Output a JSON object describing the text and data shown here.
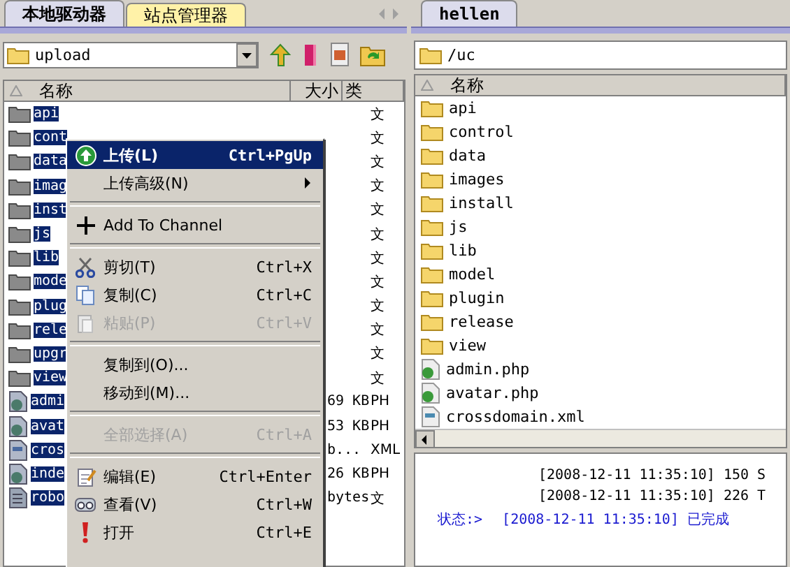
{
  "local": {
    "tabs": [
      {
        "label": "本地驱动器",
        "selected": true
      },
      {
        "label": "站点管理器",
        "selected": false
      }
    ],
    "path": "upload",
    "columns": [
      "名称",
      "大小",
      "类"
    ],
    "rows": [
      {
        "name": "api",
        "size": "",
        "type": "文",
        "kind": "folder",
        "selected": true
      },
      {
        "name": "cont",
        "size": "",
        "type": "文",
        "kind": "folder",
        "selected": true
      },
      {
        "name": "data",
        "size": "",
        "type": "文",
        "kind": "folder",
        "selected": true
      },
      {
        "name": "imag",
        "size": "",
        "type": "文",
        "kind": "folder",
        "selected": true
      },
      {
        "name": "inst",
        "size": "",
        "type": "文",
        "kind": "folder",
        "selected": true
      },
      {
        "name": "js",
        "size": "",
        "type": "文",
        "kind": "folder",
        "selected": true
      },
      {
        "name": "lib",
        "size": "",
        "type": "文",
        "kind": "folder",
        "selected": true
      },
      {
        "name": "mode",
        "size": "",
        "type": "文",
        "kind": "folder",
        "selected": true
      },
      {
        "name": "plug",
        "size": "",
        "type": "文",
        "kind": "folder",
        "selected": true
      },
      {
        "name": "rele",
        "size": "",
        "type": "文",
        "kind": "folder",
        "selected": true
      },
      {
        "name": "upgr",
        "size": "",
        "type": "文",
        "kind": "folder",
        "selected": true
      },
      {
        "name": "view",
        "size": "",
        "type": "文",
        "kind": "folder",
        "selected": true
      },
      {
        "name": "admi",
        "size": "69 KB",
        "type": "PH",
        "kind": "php",
        "selected": true
      },
      {
        "name": "avat",
        "size": "53 KB",
        "type": "PH",
        "kind": "php",
        "selected": true
      },
      {
        "name": "cros",
        "size": "b...",
        "type": "XML",
        "kind": "xml",
        "selected": true
      },
      {
        "name": "inde",
        "size": "26 KB",
        "type": "PH",
        "kind": "php",
        "selected": true
      },
      {
        "name": "robo",
        "size": "bytes",
        "type": "文",
        "kind": "text",
        "selected": true
      }
    ]
  },
  "menu": [
    {
      "kind": "item",
      "label": "上传(L)",
      "shortcut": "Ctrl+PgUp",
      "selected": true,
      "disabled": false
    },
    {
      "kind": "submenu",
      "label": "上传高级(N)",
      "selected": false,
      "disabled": false
    },
    {
      "kind": "separator"
    },
    {
      "kind": "item",
      "label": "Add To Channel",
      "selected": false,
      "disabled": false
    },
    {
      "kind": "separator"
    },
    {
      "kind": "item",
      "label": "剪切(T)",
      "shortcut": "Ctrl+X",
      "selected": false,
      "disabled": false
    },
    {
      "kind": "item",
      "label": "复制(C)",
      "shortcut": "Ctrl+C",
      "selected": false,
      "disabled": false
    },
    {
      "kind": "item",
      "label": "粘贴(P)",
      "shortcut": "Ctrl+V",
      "selected": false,
      "disabled": true
    },
    {
      "kind": "separator"
    },
    {
      "kind": "item",
      "label": "复制到(O)...",
      "selected": false,
      "disabled": false
    },
    {
      "kind": "item",
      "label": "移动到(M)...",
      "selected": false,
      "disabled": false
    },
    {
      "kind": "separator"
    },
    {
      "kind": "item",
      "label": "全部选择(A)",
      "shortcut": "Ctrl+A",
      "selected": false,
      "disabled": true
    },
    {
      "kind": "separator"
    },
    {
      "kind": "item",
      "label": "编辑(E)",
      "shortcut": "Ctrl+Enter",
      "selected": false,
      "disabled": false
    },
    {
      "kind": "item",
      "label": "查看(V)",
      "shortcut": "Ctrl+W",
      "selected": false,
      "disabled": false
    },
    {
      "kind": "item",
      "label": "打开",
      "shortcut": "Ctrl+E",
      "selected": false,
      "disabled": false
    }
  ],
  "remote": {
    "tabs": [
      {
        "label": "hellen",
        "selected": true
      }
    ],
    "path": "/uc",
    "columns": [
      "名称"
    ],
    "rows": [
      {
        "name": "api",
        "kind": "folder"
      },
      {
        "name": "control",
        "kind": "folder"
      },
      {
        "name": "data",
        "kind": "folder"
      },
      {
        "name": "images",
        "kind": "folder"
      },
      {
        "name": "install",
        "kind": "folder"
      },
      {
        "name": "js",
        "kind": "folder"
      },
      {
        "name": "lib",
        "kind": "folder"
      },
      {
        "name": "model",
        "kind": "folder"
      },
      {
        "name": "plugin",
        "kind": "folder"
      },
      {
        "name": "release",
        "kind": "folder"
      },
      {
        "name": "view",
        "kind": "folder"
      },
      {
        "name": "admin.php",
        "kind": "php"
      },
      {
        "name": "avatar.php",
        "kind": "php"
      },
      {
        "name": "crossdomain.xml",
        "kind": "xml"
      }
    ]
  },
  "log": [
    {
      "kind": "info",
      "text": "[2008-12-11 11:35:10] 150 S"
    },
    {
      "kind": "info",
      "text": "[2008-12-11 11:35:10] 226 T"
    },
    {
      "kind": "status",
      "label": "状态:>",
      "text": "[2008-12-11 11:35:10] 已完成"
    }
  ]
}
